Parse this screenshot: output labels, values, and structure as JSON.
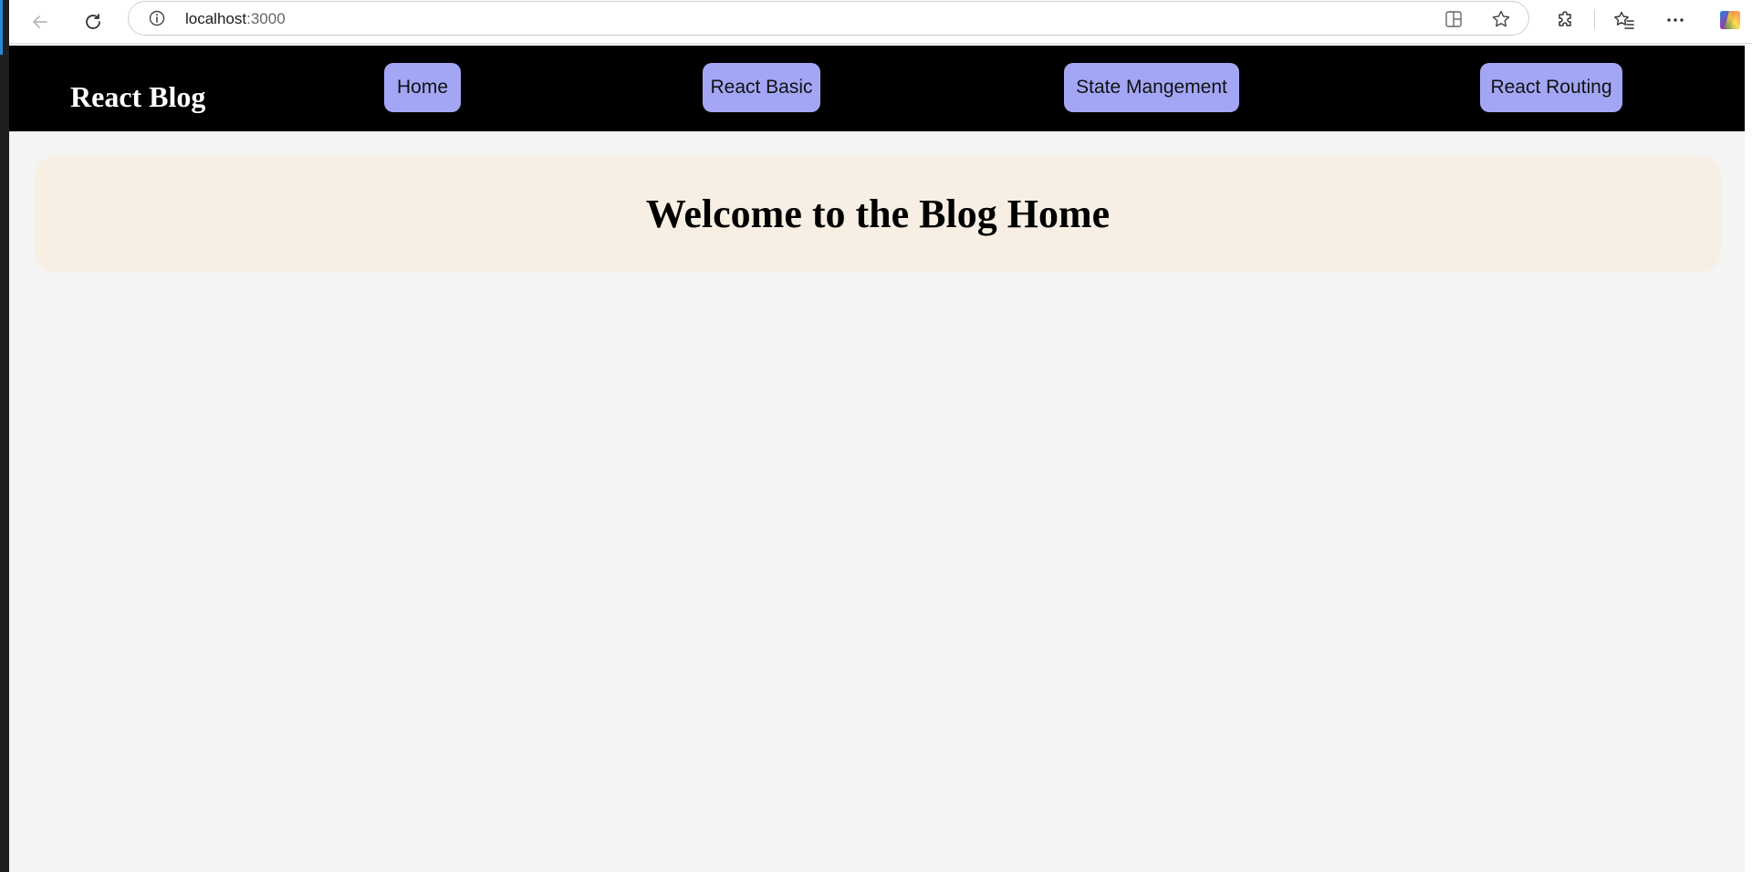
{
  "browser": {
    "url_host": "localhost",
    "url_port": ":3000",
    "icons": {
      "back": "arrow-left-icon",
      "reload": "reload-icon",
      "info": "info-icon",
      "app": "app-available-icon",
      "favorite": "star-icon",
      "extensions": "puzzle-icon",
      "favorites": "favorites-icon",
      "more": "more-icon",
      "copilot": "copilot-icon"
    }
  },
  "header": {
    "brand": "React Blog",
    "nav": [
      {
        "label": "Home"
      },
      {
        "label": "React Basic"
      },
      {
        "label": "State Mangement"
      },
      {
        "label": "React Routing"
      }
    ]
  },
  "main": {
    "title": "Welcome to the Blog Home"
  },
  "colors": {
    "header_bg": "#000000",
    "nav_button_bg": "#a3a6f5",
    "card_bg": "#f8efe4",
    "page_bg": "#f4f4f4"
  }
}
